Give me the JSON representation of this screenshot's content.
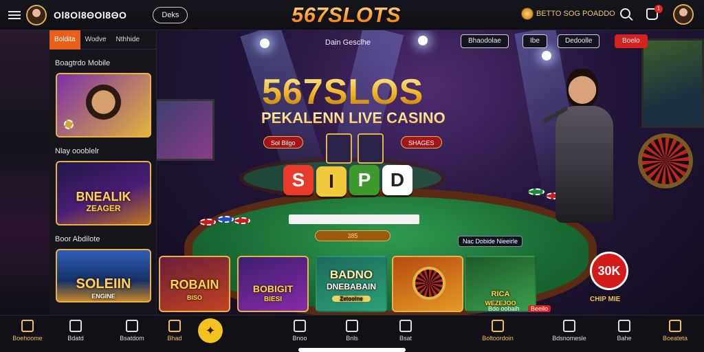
{
  "header": {
    "username": "Οl8Ol8ΘΟl8ΘΟ",
    "button": "Deks",
    "logo": "567SLOTS",
    "balance": "BETTO SOG POADDO",
    "notifications": "1"
  },
  "sidebar": {
    "tabs": [
      {
        "label": "Boldita"
      },
      {
        "label": "Wodve"
      },
      {
        "label": "Nthhide"
      }
    ],
    "sections": [
      {
        "title": "Boagtrdo Mobile"
      },
      {
        "title": "Nlay oooblelr",
        "line1": "BNEALIK",
        "line2": "ZEAGER"
      },
      {
        "title": "Boor Abdilote",
        "line1": "SOLEIIN",
        "line2": "ENGINE"
      }
    ]
  },
  "banner": {
    "subtitle": "Dain Gesclhe",
    "nav": [
      "Bhaodolae",
      "Ibe",
      "Dedoolle",
      "Boelo"
    ],
    "headline": "567SLOS",
    "subheadline": "PEKALENN LIVE CASINO",
    "tag_left": "Sol Bilgo",
    "tag_right": "SHAGES",
    "dice": [
      "S",
      "I",
      "P",
      "D"
    ],
    "bet_pill": "385",
    "stats": "Nac Dobide Nieeirle",
    "cards": [
      {
        "title": "ROBAIN",
        "sub": "BISO"
      },
      {
        "title": "BOBIGIT",
        "sub": "BIESI"
      },
      {
        "title": "BADNO",
        "sub": "DNEBABAIN",
        "tag": "Zetoolne"
      },
      {
        "title": "",
        "sub": ""
      },
      {
        "title": "RICA",
        "sub": "WEZEJOO"
      }
    ],
    "promo_caption": "Bdo oobaih",
    "promo_badge": "Beeilo",
    "percent": "30K",
    "gift_tag": "CHIP MIE"
  },
  "bottom_nav": [
    {
      "label": "Boehoome",
      "icon": "trophy-icon",
      "gold": true
    },
    {
      "label": "Bdatd",
      "icon": "home-icon",
      "gold": false
    },
    {
      "label": "Bsatdom",
      "icon": "chat-icon",
      "gold": false
    },
    {
      "label": "Bhad",
      "icon": "gift-icon",
      "gold": true
    },
    {
      "label": "Bnoo",
      "icon": "clock-icon",
      "gold": false
    },
    {
      "label": "Bnls",
      "icon": "slot-icon",
      "gold": false
    },
    {
      "label": "Bsat",
      "icon": "dice-icon",
      "gold": false
    },
    {
      "label": "Boltoordoin",
      "icon": "id-icon",
      "gold": true
    },
    {
      "label": "Bdsnomesle",
      "icon": "document-icon",
      "gold": false
    },
    {
      "label": "Bahe",
      "icon": "dice-icon",
      "gold": false
    },
    {
      "label": "Boeateta",
      "icon": "crown-icon",
      "gold": true
    }
  ],
  "colors": {
    "accent": "#e8601a",
    "gold": "#f2c14a",
    "red": "#d4221f"
  }
}
